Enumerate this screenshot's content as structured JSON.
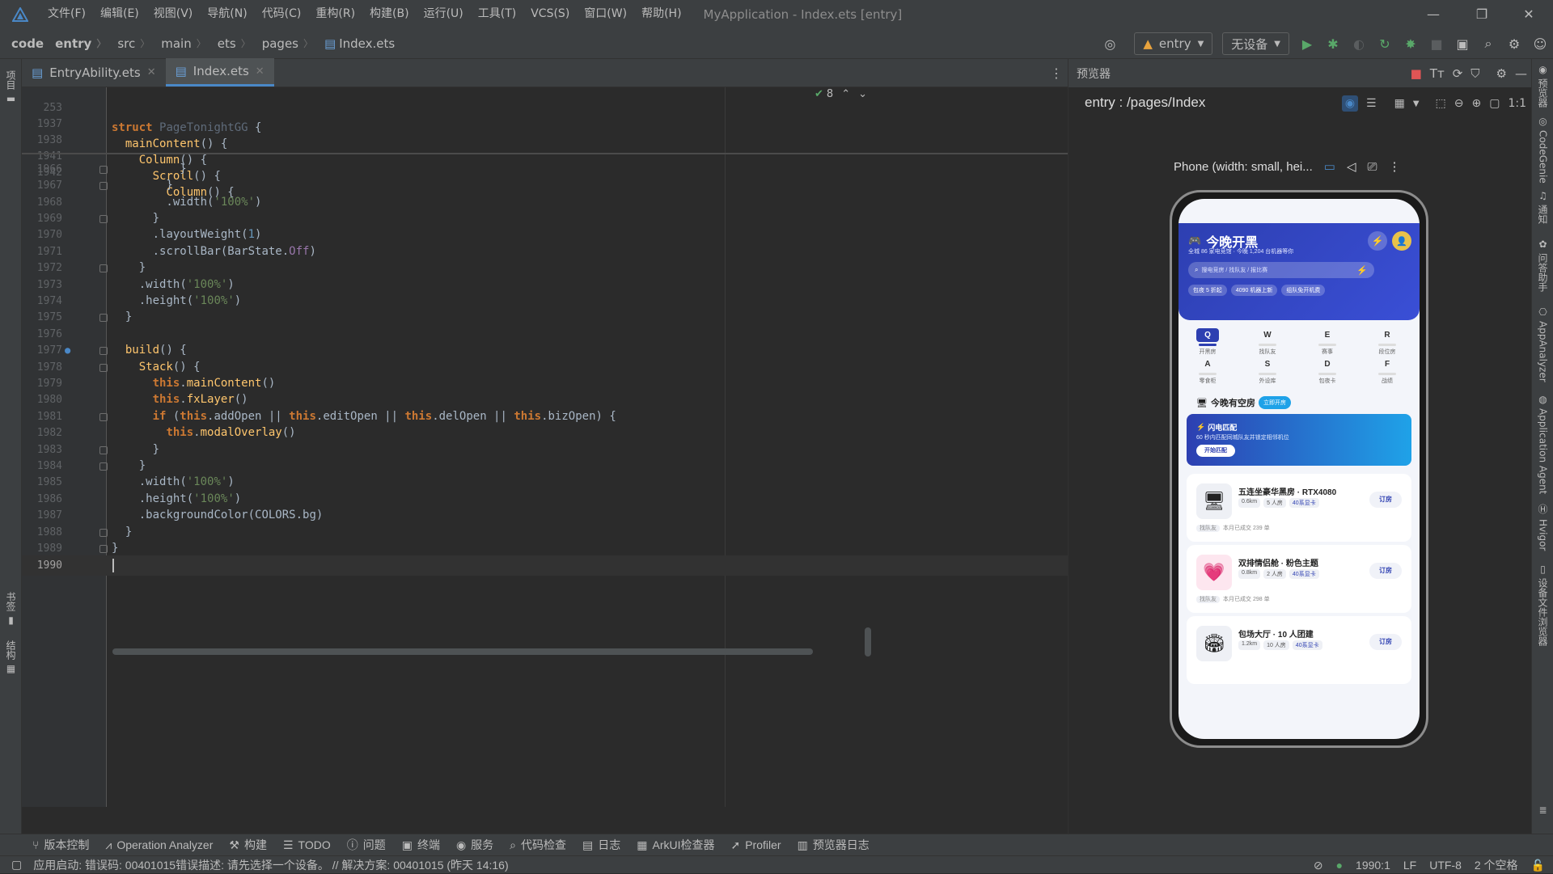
{
  "menubar": {
    "items": [
      "文件(F)",
      "编辑(E)",
      "视图(V)",
      "导航(N)",
      "代码(C)",
      "重构(R)",
      "构建(B)",
      "运行(U)",
      "工具(T)",
      "VCS(S)",
      "窗口(W)",
      "帮助(H)"
    ],
    "window_title": "MyApplication - Index.ets [entry]"
  },
  "breadcrumb": [
    "code",
    "entry",
    "src",
    "main",
    "ets",
    "pages",
    "Index.ets"
  ],
  "toolbar": {
    "module_combo": "entry",
    "device_combo": "无设备"
  },
  "editor_tabs": [
    {
      "label": "EntryAbility.ets",
      "active": false
    },
    {
      "label": "Index.ets",
      "active": true
    }
  ],
  "inspection": {
    "count": "8"
  },
  "left_strip": {
    "project": "项目",
    "bookmarks": "书签",
    "structure": "结构"
  },
  "right_strip": {
    "previewer": "预览器",
    "codegenie": "CodeGenie",
    "notifications": "通知",
    "assistant": "问答助手",
    "appanalyzer": "AppAnalyzer",
    "agent": "Application Agent",
    "hvigor": "Hvigor",
    "device_explorer": "设备文件浏览器"
  },
  "sticky_lines": [
    {
      "num": "253",
      "code": "struct PageTonightGG {"
    },
    {
      "num": "1937",
      "code": "  mainContent() {"
    },
    {
      "num": "1938",
      "code": "    Column() {"
    },
    {
      "num": "1941",
      "code": "      Scroll() {"
    },
    {
      "num": "1942",
      "code": "        Column() {"
    }
  ],
  "code_lines": [
    {
      "num": "1966",
      "code": "        }"
    },
    {
      "num": "1967",
      "code": "      }"
    },
    {
      "num": "1968",
      "code": "      .width('100%')"
    },
    {
      "num": "1969",
      "code": "    }"
    },
    {
      "num": "1970",
      "code": "    .layoutWeight(1)"
    },
    {
      "num": "1971",
      "code": "    .scrollBar(BarState.Off)"
    },
    {
      "num": "1972",
      "code": "  }"
    },
    {
      "num": "1973",
      "code": "  .width('100%')"
    },
    {
      "num": "1974",
      "code": "  .height('100%')"
    },
    {
      "num": "1975",
      "code": "}"
    },
    {
      "num": "1976",
      "code": ""
    },
    {
      "num": "1977",
      "code": "build() {"
    },
    {
      "num": "1978",
      "code": "  Stack() {"
    },
    {
      "num": "1979",
      "code": "    this.mainContent()"
    },
    {
      "num": "1980",
      "code": "    this.fxLayer()"
    },
    {
      "num": "1981",
      "code": "    if (this.addOpen || this.editOpen || this.delOpen || this.bizOpen) {"
    },
    {
      "num": "1982",
      "code": "      this.modalOverlay()"
    },
    {
      "num": "1983",
      "code": "    }"
    },
    {
      "num": "1984",
      "code": "  }"
    },
    {
      "num": "1985",
      "code": "  .width('100%')"
    },
    {
      "num": "1986",
      "code": "  .height('100%')"
    },
    {
      "num": "1987",
      "code": "  .backgroundColor(COLORS.bg)"
    },
    {
      "num": "1988",
      "code": "}"
    },
    {
      "num": "1989",
      "code": "}"
    },
    {
      "num": "1990",
      "code": ""
    }
  ],
  "preview": {
    "header": "预览器",
    "route": "entry : /pages/Index",
    "device": "Phone (width: small, hei...",
    "app": {
      "title": "今晚开黑",
      "subtitle": "全城 86 家电竞馆 · 今晚 1,204 台机器等你",
      "search_placeholder": "搜电竞房 / 找队友 / 报比赛",
      "chips": [
        "包夜 5 折起",
        "4090 机器上新",
        "组队免开机费"
      ],
      "keys": [
        {
          "key": "Q",
          "label": "开黑房"
        },
        {
          "key": "W",
          "label": "找队友"
        },
        {
          "key": "E",
          "label": "赛事"
        },
        {
          "key": "R",
          "label": "段位房"
        },
        {
          "key": "A",
          "label": "零食柜"
        },
        {
          "key": "S",
          "label": "外设库"
        },
        {
          "key": "D",
          "label": "包夜卡"
        },
        {
          "key": "F",
          "label": "战绩"
        }
      ],
      "section_title": "今晚有空房",
      "section_badge": "立即开房",
      "banner_title": "闪电匹配",
      "banner_desc": "60 秒内匹配同城队友并锁定相邻机位",
      "banner_button": "开始匹配",
      "rooms": [
        {
          "icon": "🖥",
          "name": "五连坐豪华黑房 · RTX4080",
          "dist": "0.6km",
          "people": "5 人房",
          "card": "40系显卡",
          "book": "订房",
          "sub": "本月已成交 239 单",
          "team": "找队友"
        },
        {
          "icon": "💗",
          "name": "双排情侣舱 · 粉色主题",
          "dist": "0.8km",
          "people": "2 人房",
          "card": "40系显卡",
          "book": "订房",
          "sub": "本月已成交 298 单",
          "team": "找队友"
        },
        {
          "icon": "🏟",
          "name": "包场大厅 · 10 人团建",
          "dist": "1.2km",
          "people": "10 人房",
          "card": "40系显卡",
          "book": "订房",
          "sub": "",
          "team": ""
        }
      ]
    }
  },
  "bottom_bar": [
    "版本控制",
    "Operation Analyzer",
    "构建",
    "TODO",
    "问题",
    "终端",
    "服务",
    "代码检查",
    "日志",
    "ArkUI检查器",
    "Profiler",
    "预览器日志"
  ],
  "status_bar": {
    "message": "应用启动: 错误码: 00401015错误描述: 请先选择一个设备。 // 解决方案: 00401015 (昨天 14:16)",
    "position": "1990:1",
    "line_sep": "LF",
    "encoding": "UTF-8",
    "indent": "2 个空格"
  },
  "colors": {
    "accent": "#4a88c7",
    "app_primary": "#2d3fb1",
    "run_green": "#59a869"
  }
}
